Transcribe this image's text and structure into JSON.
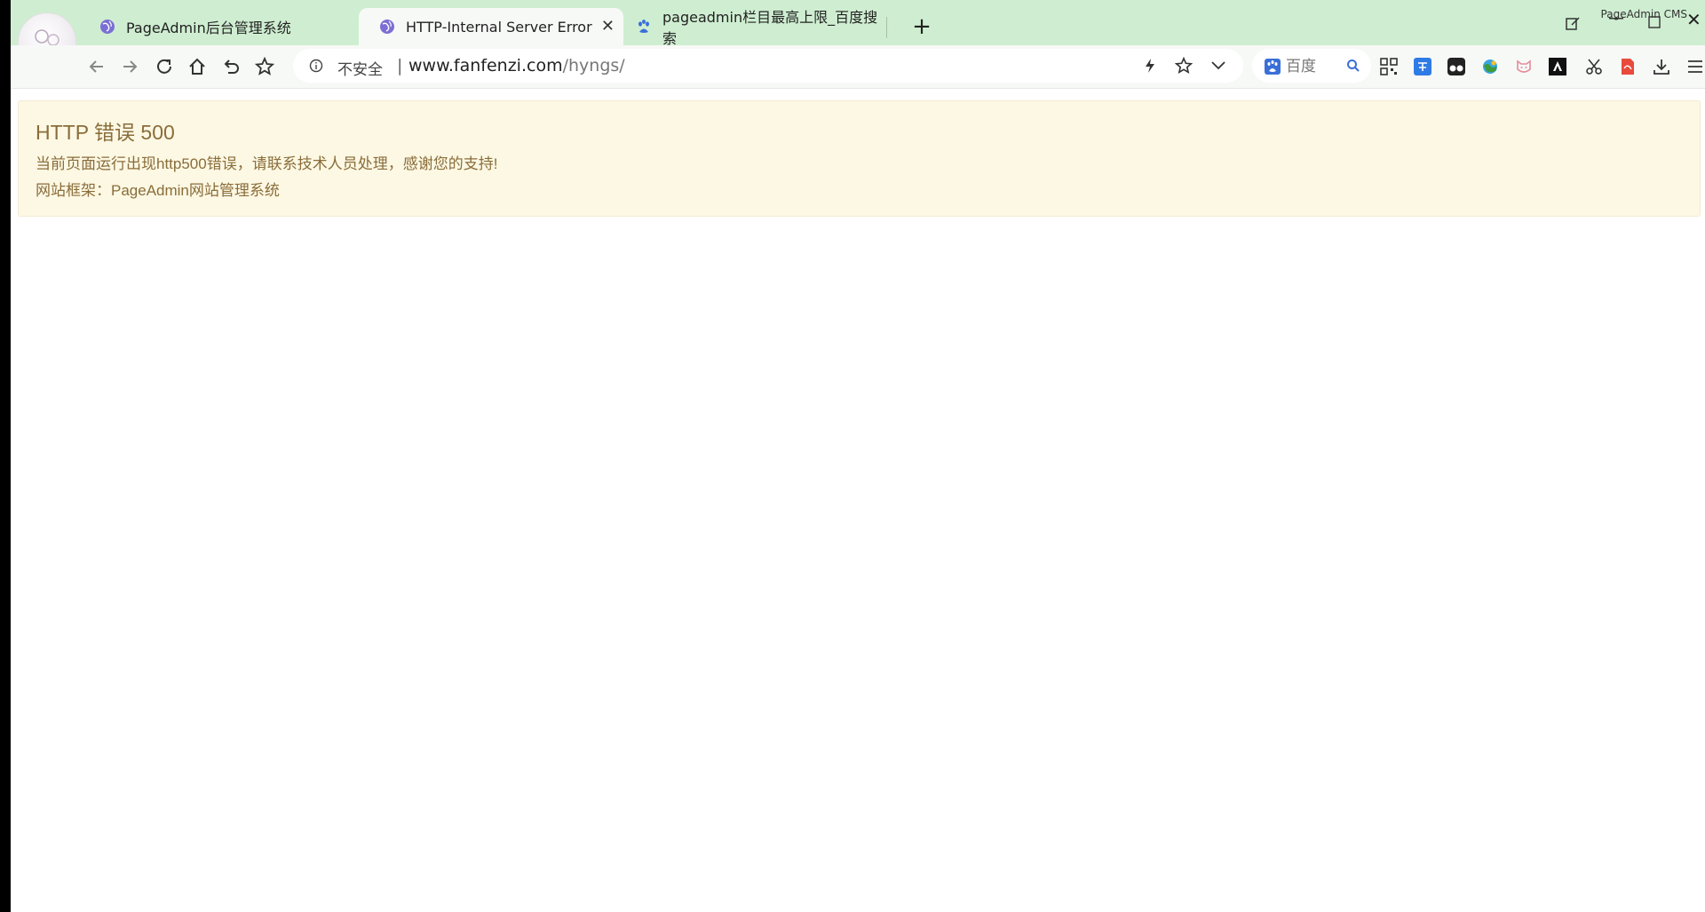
{
  "browser": {
    "tabs": [
      {
        "title": "PageAdmin后台管理系统",
        "active": false
      },
      {
        "title": "HTTP-Internal Server Error",
        "active": true
      },
      {
        "title": "pageadmin栏目最高上限_百度搜索",
        "active": false
      }
    ],
    "new_tab_label": "+",
    "app_label": "PageAdmin CMS",
    "close_tab_glyph": "✕",
    "close_window_glyph": "✕"
  },
  "address_bar": {
    "security_label": "不安全",
    "separator": "|",
    "url_host": "www.fanfenzi.com",
    "url_path": "/hyngs/"
  },
  "search": {
    "engine": "baidu-icon",
    "placeholder": "百度"
  },
  "error": {
    "title": "HTTP 错误 500",
    "message": "当前页面运行出现http500错误，请联系技术人员处理，感谢您的支持!",
    "framework": "网站框架：PageAdmin网站管理系统"
  },
  "colors": {
    "tabbar_bg": "#cfeed1",
    "toolbar_bg": "#f7f9f7",
    "alert_bg": "#fcf8e3",
    "alert_text": "#8a6d3b"
  }
}
